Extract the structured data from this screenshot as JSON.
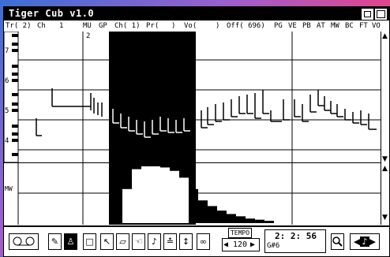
{
  "window": {
    "title": "Tiger Cub v1.0"
  },
  "header": {
    "tr": "Tr( 2)",
    "ch": "Ch",
    "ch_val": "1",
    "mu": "MU",
    "gp": "GP",
    "ch2": "Ch( 1)",
    "pr": "Pr(",
    "pr_close": ")",
    "vo": "Vo(",
    "vo_close": ")",
    "off": "Off( 696)",
    "pg": "PG",
    "ve": "VE",
    "pb": "PB",
    "at": "AT",
    "mw": "MW",
    "bc": "BC",
    "ft": "FT",
    "vo2": "VO"
  },
  "roll": {
    "measure_label": "2",
    "octave_labels": [
      "7",
      "6",
      "5",
      "4"
    ]
  },
  "velocity": {
    "label": "MW"
  },
  "toolbar": {
    "tempo_label": "TEMPO",
    "tempo_value": "120",
    "position": "2: 2: 56",
    "note": "G#6",
    "tools": [
      "tape-deck",
      "pencil",
      "metronome",
      "select-box",
      "arrow",
      "eraser",
      "note",
      "quantize",
      "transpose",
      "scissors-loop"
    ]
  },
  "chart_data": {
    "type": "bar",
    "title": "",
    "xlabel": "",
    "ylabel": "MW",
    "values_note": "mod wheel envelope",
    "series": [
      {
        "values": [
          0,
          0,
          60,
          95,
          100,
          100,
          98,
          92,
          80,
          60,
          40,
          30,
          22,
          16,
          12,
          8,
          6,
          4,
          0,
          0,
          0
        ]
      }
    ]
  }
}
